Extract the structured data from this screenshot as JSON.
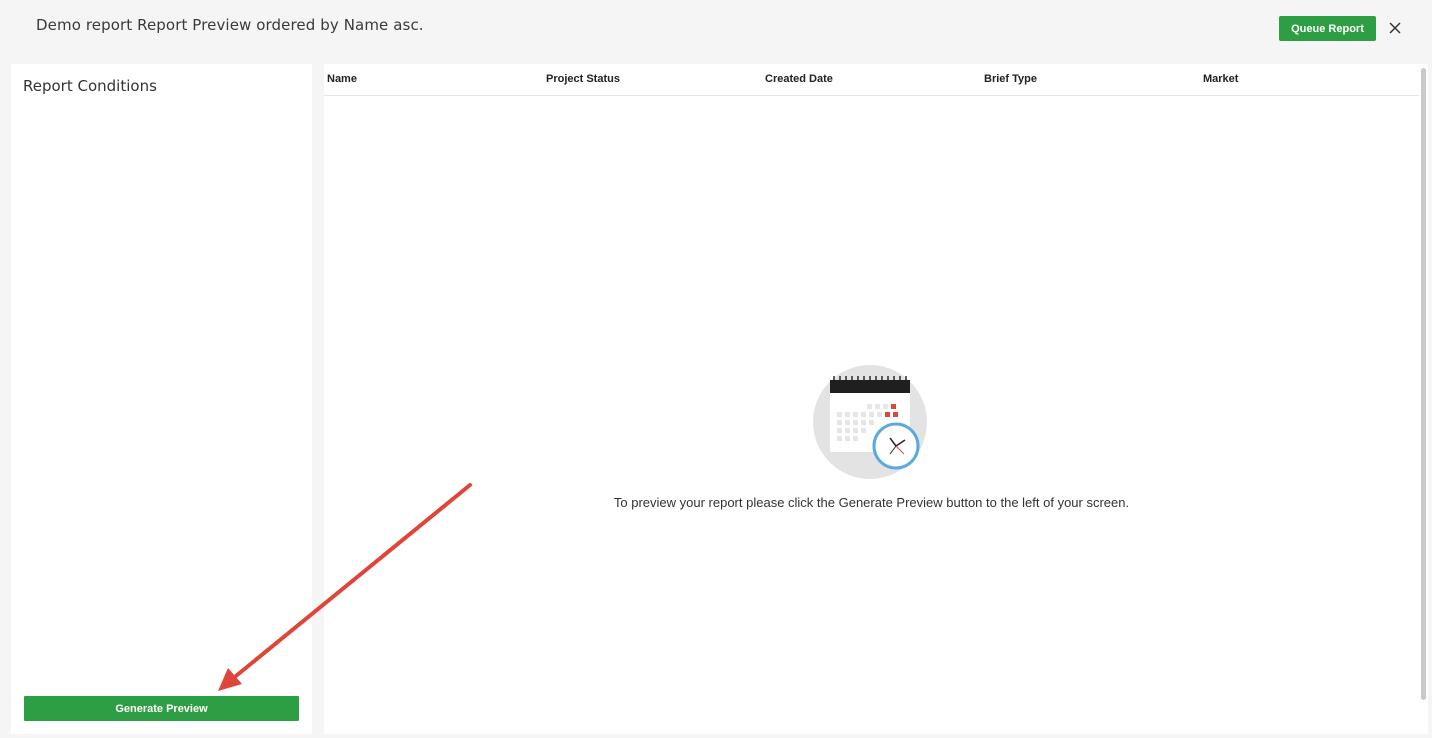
{
  "header": {
    "title": "Demo report Report Preview ordered by Name asc.",
    "queue_button_label": "Queue Report",
    "close_icon": "close-icon"
  },
  "sidebar": {
    "title": "Report Conditions",
    "generate_button_label": "Generate Preview"
  },
  "table": {
    "columns": [
      "Name",
      "Project Status",
      "Created Date",
      "Brief Type",
      "Market"
    ]
  },
  "empty_state": {
    "icon": "calendar-clock-icon",
    "message": "To preview your report please click the Generate Preview button to the left of your screen."
  },
  "annotation": {
    "icon": "red-arrow-annotation"
  },
  "colors": {
    "accent_green": "#2e9e44",
    "annotation_red": "#e0453a",
    "background": "#f5f5f5"
  }
}
